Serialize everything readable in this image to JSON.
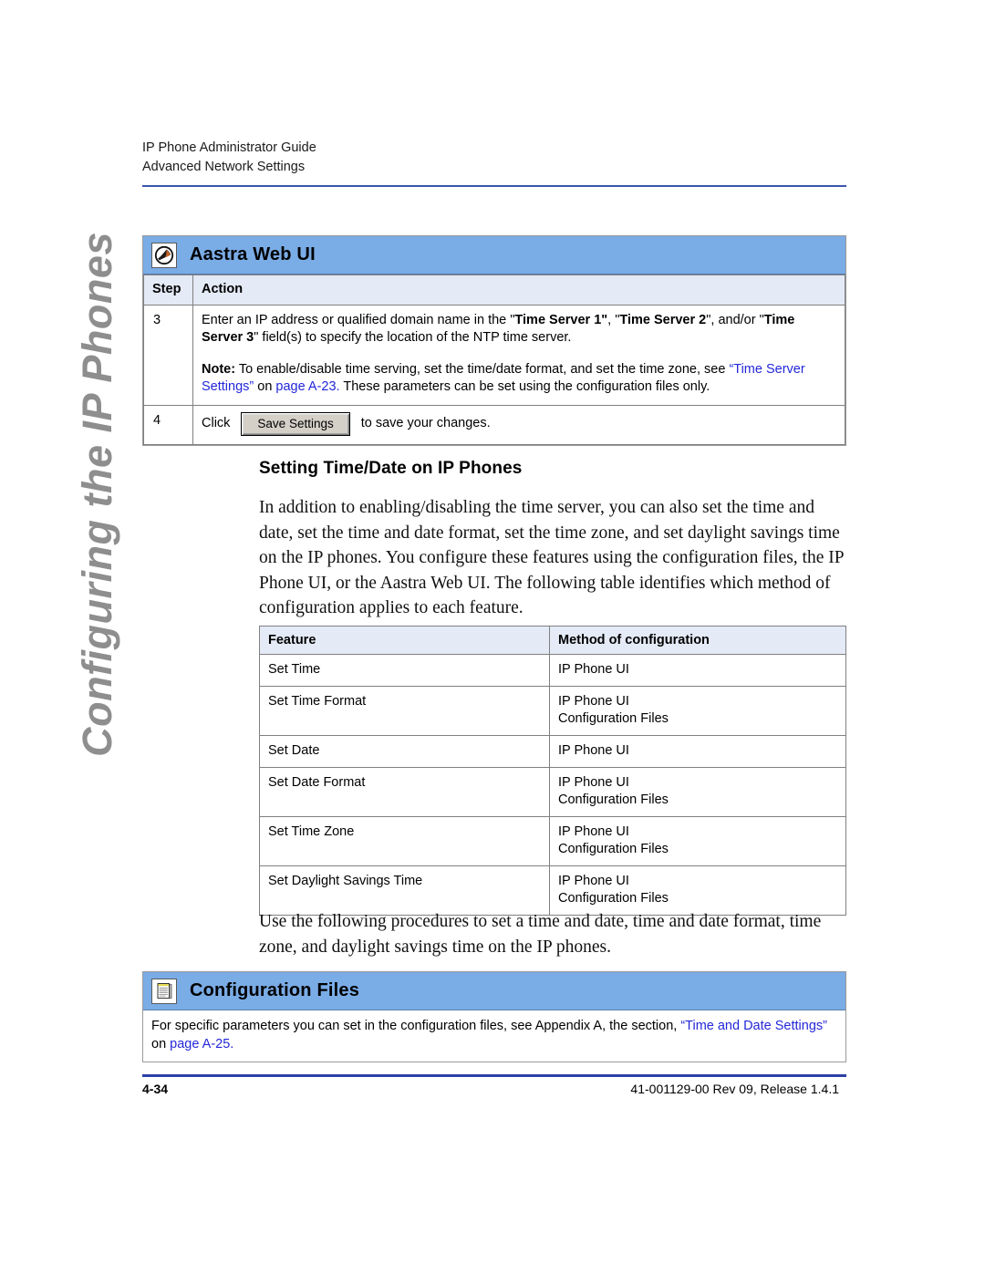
{
  "running_header": {
    "line1": "IP Phone Administrator Guide",
    "line2": "Advanced Network Settings"
  },
  "side_tab": {
    "label": "Configuring the IP Phones"
  },
  "aastra_callout": {
    "icon": "aastra-globe-phone-icon",
    "title": "Aastra Web UI",
    "columns": [
      "Step",
      "Action"
    ],
    "rows": [
      {
        "step": "3",
        "action_part1_a": "Enter an IP address or qualified domain name in the \"",
        "action_bold1": "Time Server 1\"",
        "action_part1_b": ", \"",
        "action_bold2": "Time Server 2",
        "action_part1_c": "\", and/or \"",
        "action_bold3": "Time Server 3",
        "action_part1_d": "\" field(s) to specify the location of the NTP time server.",
        "note_label": "Note:",
        "note_text_a": " To enable/disable time serving, set the time/date format, and set the time zone, see ",
        "note_link1": "“Time Server Settings”",
        "note_text_b": " on ",
        "note_link2": "page A-23.",
        "note_text_c": " These parameters can be set using the configuration files only."
      },
      {
        "step": "4",
        "click_prefix": "Click",
        "button_label": "Save Settings",
        "click_suffix": "to save your changes."
      }
    ]
  },
  "section": {
    "heading": "Setting Time/Date on IP Phones",
    "paragraph": "In addition to enabling/disabling the time server, you can also set the time and date, set the time and date format, set the time zone, and set daylight savings time on the IP phones. You configure these features using the configuration files, the IP Phone UI, or the Aastra Web UI. The following table identifies which method of configuration applies to each feature.",
    "paragraph2": "Use the following procedures to set a time and date, time and date format, time zone, and daylight savings time on the IP phones."
  },
  "feature_table": {
    "columns": [
      "Feature",
      "Method of configuration"
    ],
    "rows": [
      {
        "feature": "Set Time",
        "method": "IP Phone UI"
      },
      {
        "feature": "Set Time Format",
        "method": "IP Phone UI\nConfiguration Files"
      },
      {
        "feature": "Set Date",
        "method": "IP Phone UI"
      },
      {
        "feature": "Set Date Format",
        "method": "IP Phone UI\nConfiguration Files"
      },
      {
        "feature": "Set Time Zone",
        "method": "IP Phone UI\nConfiguration Files"
      },
      {
        "feature": "Set Daylight Savings Time",
        "method": "IP Phone UI\nConfiguration Files"
      }
    ]
  },
  "config_callout": {
    "icon": "notepad-document-icon",
    "title": "Configuration Files",
    "text_a": "For specific parameters you can set in the configuration files, see Appendix A, the section, ",
    "link1": "“Time and Date Settings”",
    "text_b": " on ",
    "link2": "page A-25."
  },
  "footer": {
    "page_number": "4-34",
    "doc_ref": "41-001129-00 Rev 09, Release 1.4.1"
  },
  "colors": {
    "callout_blue": "#7AACE6",
    "table_header_blue": "#E4EAF6",
    "link_blue": "#2327D8",
    "rule_blue": "#3B55B0",
    "side_tab_gray": "#8E8E8E"
  }
}
